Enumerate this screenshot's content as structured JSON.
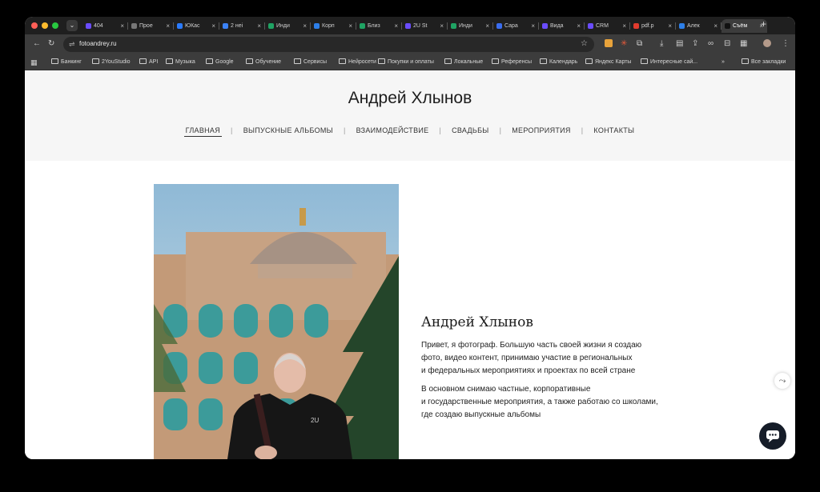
{
  "browser": {
    "tabs": [
      {
        "label": "404",
        "color": "#6a4cff"
      },
      {
        "label": "Прое",
        "color": "#777777"
      },
      {
        "label": "ЮКас",
        "color": "#2a7bff"
      },
      {
        "label": "2 неі",
        "color": "#3b82f6"
      },
      {
        "label": "Инди",
        "color": "#1fa363"
      },
      {
        "label": "Корп",
        "color": "#2d7fe8"
      },
      {
        "label": "Близ",
        "color": "#1fa363"
      },
      {
        "label": "2U St",
        "color": "#6a4cff"
      },
      {
        "label": "Инди",
        "color": "#1fa363"
      },
      {
        "label": "Сара",
        "color": "#3a6df0"
      },
      {
        "label": "Вида",
        "color": "#6a4cff"
      },
      {
        "label": "CRM",
        "color": "#6a4cff"
      },
      {
        "label": "pdf.p",
        "color": "#e23b2e"
      },
      {
        "label": "Алек",
        "color": "#2d7fe8"
      },
      {
        "label": "Съём",
        "color": "#111111"
      }
    ],
    "url": "fotoandrey.ru",
    "bookmarks": [
      "Банкинг",
      "2YouStudio",
      "API",
      "Музыка",
      "Google",
      "Обучение",
      "Сервисы",
      "Нейросети",
      "Покупки и оплаты",
      "Локальные",
      "Референсы",
      "Календарь",
      "Яндекс Карты",
      "Интересные сай..."
    ],
    "all_bookmarks": "Все закладки",
    "overflow": "»"
  },
  "site": {
    "title": "Андрей Хлынов",
    "nav": [
      "ГЛАВНАЯ",
      "ВЫПУСКНЫЕ АЛЬБОМЫ",
      "ВЗАИМОДЕЙСТВИЕ",
      "СВАДЬБЫ",
      "МЕРОПРИЯТИЯ",
      "КОНТАКТЫ"
    ],
    "nav_separator": "|",
    "bio_name": "Андрей Хлынов",
    "bio_p1": [
      "Привет, я фотограф. Большую часть своей жизни я создаю",
      "фото, видео контент, принимаю участие в региональных",
      "и федеральных мероприятиях и проектах по всей стране"
    ],
    "bio_p2": [
      "В основном снимаю частные, корпоративные",
      "и государственные мероприятия, а также работаю со школами,",
      "где создаю выпускные альбомы"
    ],
    "shirt_logo": "2U"
  },
  "colors": {
    "accent": "#151c28",
    "header_bg": "#f6f6f6"
  }
}
